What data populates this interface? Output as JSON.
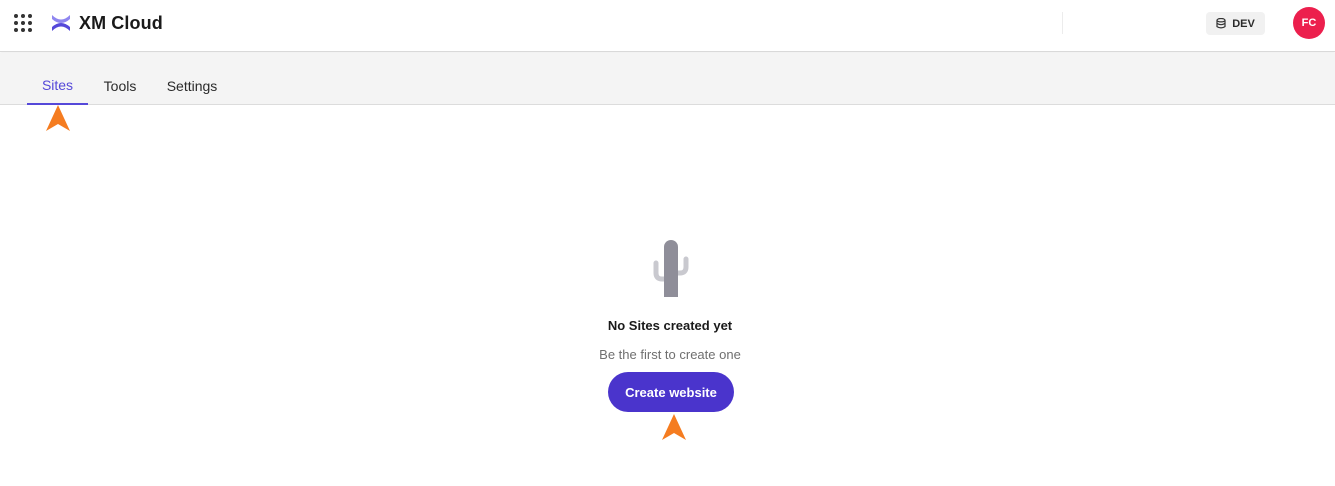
{
  "header": {
    "app_title": "XM Cloud",
    "environment_label": "DEV",
    "avatar_initials": "FC",
    "apps_icon": "grid-dots-icon",
    "logo_icon": "xm-cloud-logo",
    "env_icon": "database-icon"
  },
  "tabs": [
    {
      "label": "Sites",
      "active": true
    },
    {
      "label": "Tools",
      "active": false
    },
    {
      "label": "Settings",
      "active": false
    }
  ],
  "empty_state": {
    "illustration": "cactus-icon",
    "title": "No Sites created yet",
    "subtitle": "Be the first to create one",
    "button_label": "Create website"
  },
  "colors": {
    "accent": "#5548d9",
    "primary_button": "#4a34cc",
    "avatar": "#ec1f4d",
    "pointer": "#f57c20"
  }
}
